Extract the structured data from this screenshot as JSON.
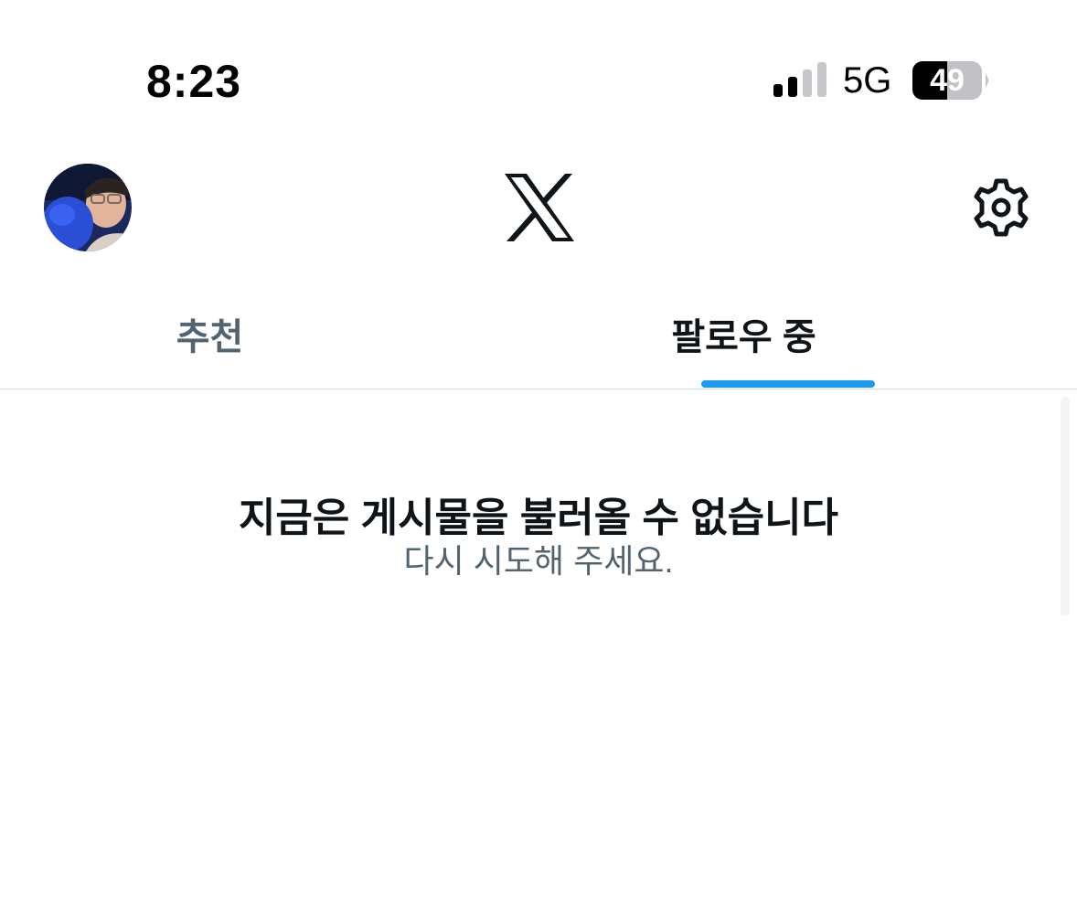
{
  "status_bar": {
    "time": "8:23",
    "network": "5G",
    "battery_level": "49",
    "signal_icon": "cellular-signal-icon",
    "battery_icon": "battery-icon"
  },
  "header": {
    "avatar_icon": "profile-avatar",
    "logo_icon": "x-logo-icon",
    "settings_icon": "gear-icon"
  },
  "tabs": [
    {
      "label": "추천",
      "active": false
    },
    {
      "label": "팔로우 중",
      "active": true
    }
  ],
  "empty_state": {
    "title": "지금은 게시물을 불러올 수 없습니다",
    "subtitle": "다시 시도해 주세요."
  },
  "colors": {
    "accent": "#1d9bf0",
    "text_primary": "#0f1419",
    "text_secondary": "#536471",
    "divider": "#cfd9de"
  }
}
